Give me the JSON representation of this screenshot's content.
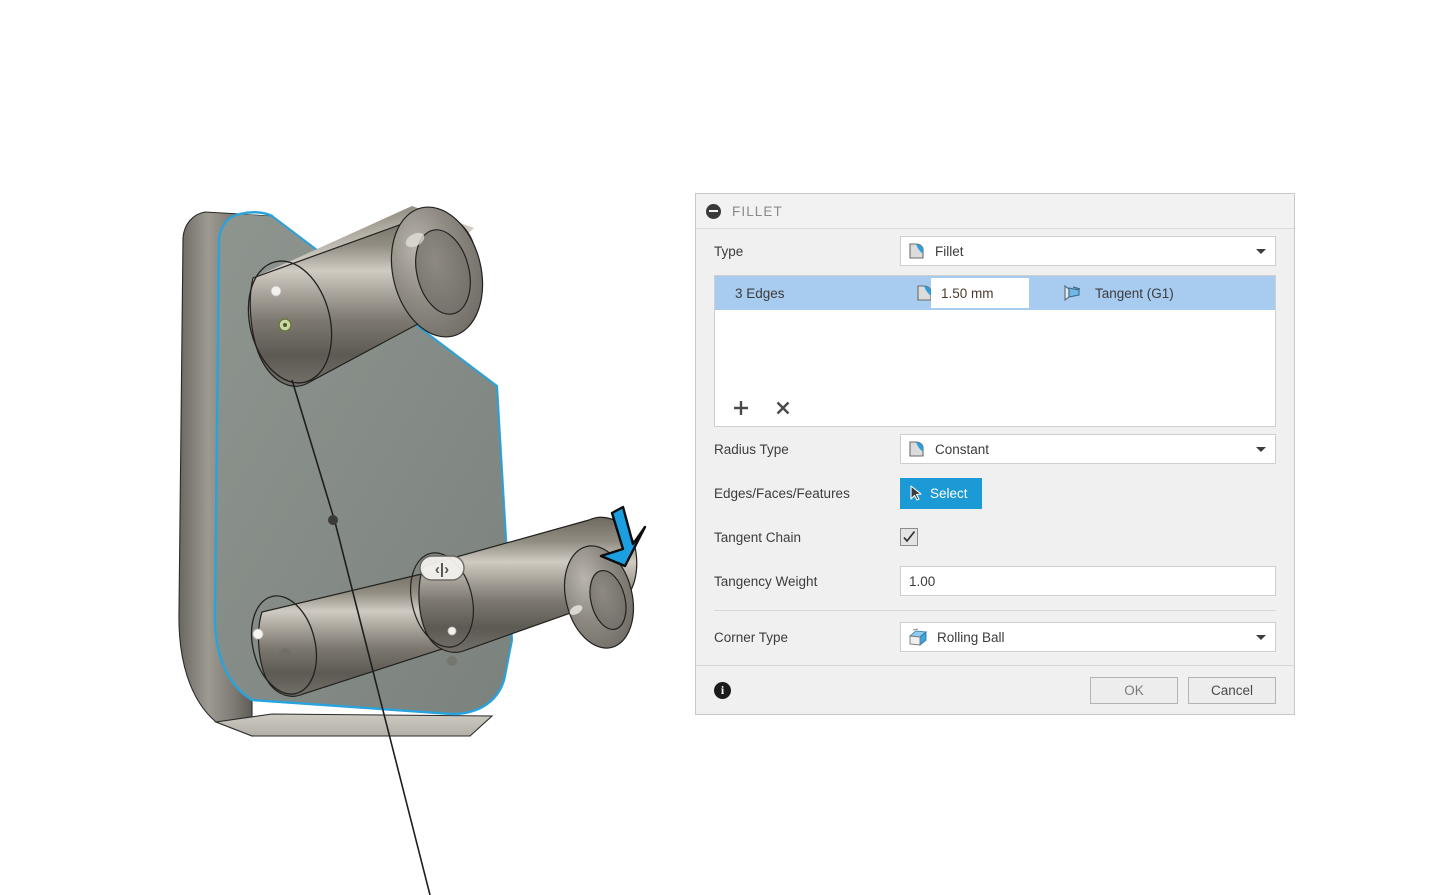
{
  "dialog": {
    "title": "FILLET",
    "collapse_icon": "collapse-minus-icon",
    "type_row": {
      "label": "Type",
      "value": "Fillet",
      "icon": "fillet-icon",
      "caret": "chevron-down-icon"
    },
    "edge_list": {
      "selected_row": {
        "label": "3 Edges",
        "radius_icon": "fillet-icon",
        "radius_value": "1.50 mm",
        "continuity_icon": "tangent-g1-icon",
        "continuity_label": "Tangent (G1)"
      },
      "add_button": "+",
      "remove_button": "×"
    },
    "radius_type_row": {
      "label": "Radius Type",
      "value": "Constant",
      "icon": "fillet-icon",
      "caret": "chevron-down-icon"
    },
    "selection_row": {
      "label": "Edges/Faces/Features",
      "button_label": "Select",
      "button_icon": "cursor-arrow-icon"
    },
    "tangent_chain_row": {
      "label": "Tangent Chain",
      "checked": true
    },
    "tangency_weight_row": {
      "label": "Tangency Weight",
      "value": "1.00"
    },
    "corner_type_row": {
      "label": "Corner Type",
      "value": "Rolling Ball",
      "icon": "rolling-ball-icon",
      "caret": "chevron-down-icon"
    },
    "footer": {
      "info_icon": "info-icon",
      "ok_label": "OK",
      "cancel_label": "Cancel"
    }
  },
  "viewport": {
    "annotation": "blue-down-arrow-pointer",
    "model_name": "triangular-bracket-with-three-pins",
    "highlight_color": "#29a3dc",
    "accent_color": "#1b9ad6",
    "selection_row_color": "#a8cbf0"
  }
}
